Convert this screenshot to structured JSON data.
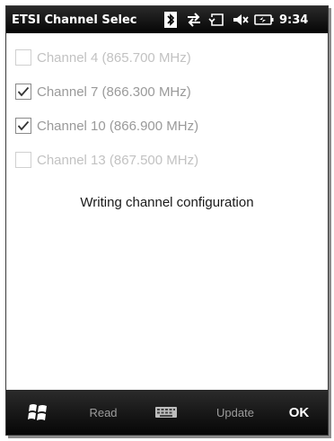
{
  "title_bar": {
    "app_title": "ETSI Channel Selec",
    "time": "9:34",
    "icons": [
      "bluetooth-icon",
      "data-connection-icon",
      "sync-icon",
      "volume-muted-icon",
      "battery-icon"
    ]
  },
  "channels": [
    {
      "label": "Channel 4 (865.700 MHz)",
      "checked": false,
      "enabled": false
    },
    {
      "label": "Channel 7 (866.300 MHz)",
      "checked": true,
      "enabled": true
    },
    {
      "label": "Channel 10 (866.900 MHz)",
      "checked": true,
      "enabled": true
    },
    {
      "label": "Channel 13 (867.500 MHz)",
      "checked": false,
      "enabled": false
    }
  ],
  "status_message": "Writing channel configuration",
  "softkeys": {
    "read_label": "Read",
    "update_label": "Update",
    "ok_label": "OK"
  },
  "colors": {
    "bar_background": "#0a0a0a",
    "disabled_softkey_text": "#9c9c9c",
    "channel_text": "#9a9a9a",
    "disabled_channel_text": "#c2c2c2"
  }
}
